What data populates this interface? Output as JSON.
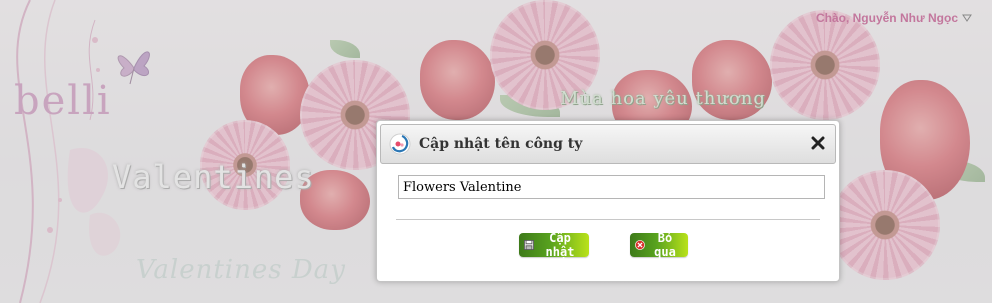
{
  "header": {
    "greeting": "Chào, Nguyễn Như Ngọc",
    "dropdown_icon": "triangle-down-icon"
  },
  "banner": {
    "logo_text": "belli",
    "headline": "Valentines",
    "slogan": "Mùa hoa yêu thương",
    "caption": "Valentines Day"
  },
  "dialog": {
    "title": "Cập nhật tên công ty",
    "icon": "app-logo-icon",
    "close_icon": "close-icon",
    "input_value": "Flowers Valentine",
    "buttons": {
      "update_label": "Cập nhật",
      "update_icon": "save-icon",
      "cancel_label": "Bỏ qua",
      "cancel_icon": "cancel-icon"
    }
  },
  "colors": {
    "greeting": "#c3779d",
    "button_gradient_start": "#3e7a1a",
    "button_gradient_end": "#b9e21a"
  }
}
